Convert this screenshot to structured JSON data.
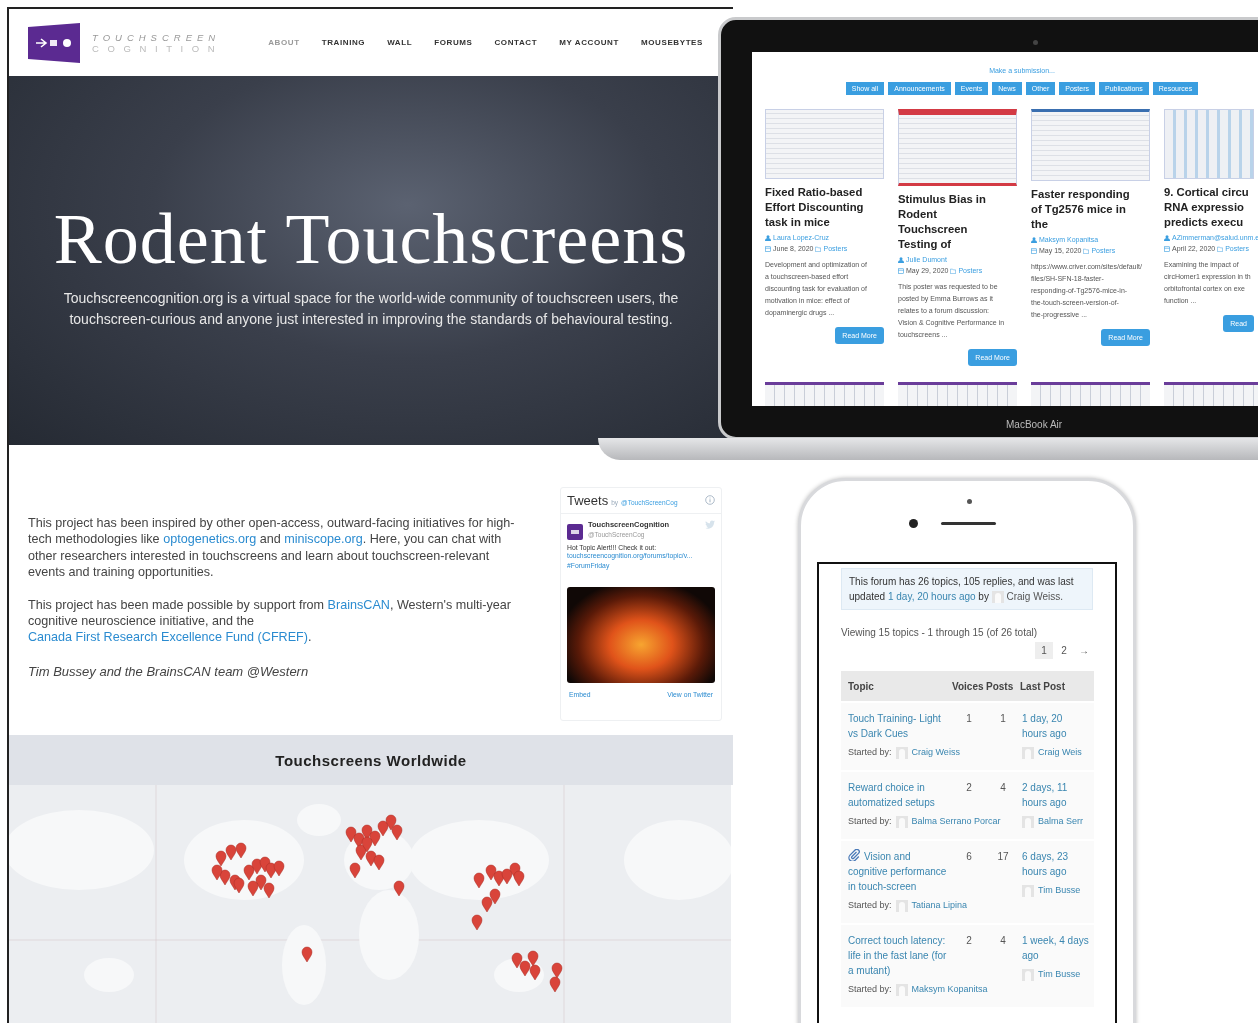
{
  "header": {
    "logo_line1": "TOUCHSCREEN",
    "logo_line2": "COGNITION",
    "nav": [
      {
        "label": "ABOUT",
        "selected": true
      },
      {
        "label": "TRAINING",
        "selected": false
      },
      {
        "label": "WALL",
        "selected": false
      },
      {
        "label": "FORUMS",
        "selected": false
      },
      {
        "label": "CONTACT",
        "selected": false
      },
      {
        "label": "MY ACCOUNT",
        "selected": false
      },
      {
        "label": "MOUSEBYTES",
        "selected": false
      }
    ]
  },
  "hero": {
    "title": "Rodent Touchscreens",
    "text": "Touchscreencognition.org is a virtual space for the world-wide community of touchscreen users, the touchscreen-curious and anyone just interested in improving the standards of behavioural testing."
  },
  "intro": {
    "paragraphs": [
      [
        {
          "text": "This project has been inspired by other open-access, outward-facing initiatives for high-tech methodologies like ",
          "link": false
        },
        {
          "text": "optogenetics.org",
          "link": true
        },
        {
          "text": " and ",
          "link": false
        },
        {
          "text": "miniscope.org",
          "link": true
        },
        {
          "text": ". Here, you can chat with other researchers interested in touchscreens and learn about touchscreen-relevant events and training opportunities.",
          "link": false
        }
      ],
      [
        {
          "text": "This project has been made possible by support from ",
          "link": false
        },
        {
          "text": "BrainsCAN",
          "link": true
        },
        {
          "text": ", Western's multi-year cognitive neuroscience initiative, and the ",
          "link": false
        },
        {
          "text": "Canada First Research Excellence Fund (CFREF)",
          "link": true
        },
        {
          "text": ".",
          "link": false
        }
      ]
    ],
    "signature": "Tim Bussey and the BrainsCAN team @Western"
  },
  "tweets": {
    "title": "Tweets",
    "by": "by",
    "handle": "@TouchScreenCog",
    "account_name": "TouchscreenCognition",
    "account_handle": "@TouchScreenCog",
    "text": "Hot Topic Alert!!!  Check it out:",
    "link": "touchscreencognition.org/forums/topic/v...",
    "hashtag": "#ForumFriday",
    "embed": "Embed",
    "view": "View on Twitter"
  },
  "map": {
    "title": "Touchscreens Worldwide"
  },
  "laptop": {
    "label": "MacBook Air",
    "submission": "Make a submission...",
    "filters": [
      "Show all",
      "Announcements",
      "Events",
      "News",
      "Other",
      "Posters",
      "Publications",
      "Resources"
    ],
    "cards": [
      {
        "title": "Fixed Ratio-based\nEffort Discounting\ntask in mice",
        "author": "Laura Lopez-Cruz",
        "date": "June 8, 2020",
        "category": "Posters",
        "excerpt": "Development and optimization of\na touchscreen-based effort\ndiscounting task for evaluation of\nmotivation in mice: effect of\ndopaminergic drugs ...",
        "button": "Read More"
      },
      {
        "title": "Stimulus Bias in\nRodent\nTouchscreen\nTesting of",
        "author": "Julie Dumont",
        "date": "May 29, 2020",
        "category": "Posters",
        "excerpt": "This poster was requested to be\nposted by Emma Burrows as it\nrelates to a forum discussion:\nVision & Cognitive Performance in\ntouchscreens ...",
        "button": "Read More"
      },
      {
        "title": "Faster responding\nof Tg2576 mice in\nthe",
        "author": "Maksym Kopanitsa",
        "date": "May 15, 2020",
        "category": "Posters",
        "excerpt": "https://www.criver.com/sites/default/\nfiles/SH-SFN-18-faster-\nresponding-of-Tg2576-mice-in-\nthe-touch-screen-version-of-\nthe-progressive ...",
        "button": "Read More"
      },
      {
        "title": "9. Cortical circu\nRNA expressio\npredicts execu",
        "author": "AZimmerman@salud.unm.e",
        "date": "April 22, 2020",
        "category": "Posters",
        "excerpt": "Examining the impact of\ncircHomer1 expression in th\norbitofrontal cortex on exe\nfunction ...",
        "button": "Read"
      }
    ]
  },
  "phone": {
    "notice": {
      "text": "This forum has 26 topics, 105 replies, and was last updated",
      "freshness": "1 day, 20 hours ago",
      "by": "by",
      "user": "Craig Weiss."
    },
    "viewing": "Viewing 15 topics - 1 through 15 (of 26 total)",
    "pages": [
      {
        "label": "1",
        "selected": true
      },
      {
        "label": "2",
        "selected": false
      },
      {
        "label": "→",
        "selected": false
      }
    ],
    "columns": [
      "Topic",
      "Voices",
      "Posts",
      "Last Post"
    ],
    "rows": [
      {
        "topic": "Touch Training- Light vs Dark Cues",
        "attachment": false,
        "voices": "1",
        "posts": "1",
        "freshness": "1 day, 20 hours ago",
        "started_label": "Started by:",
        "author": "Craig Weiss",
        "last_author": "Craig Weis"
      },
      {
        "topic": "Reward choice in automatized setups",
        "attachment": false,
        "voices": "2",
        "posts": "4",
        "freshness": "2 days, 11 hours ago",
        "started_label": "Started by:",
        "author": "Balma Serrano Porcar",
        "last_author": "Balma Serr"
      },
      {
        "topic": "Vision and cognitive performance in touch-screen",
        "attachment": true,
        "voices": "6",
        "posts": "17",
        "freshness": "6 days, 23 hours ago",
        "started_label": "Started by:",
        "author": "Tatiana Lipina",
        "last_author": "Tim Busse"
      },
      {
        "topic": "Correct touch latency: life in the fast lane (for a mutant)",
        "attachment": false,
        "voices": "2",
        "posts": "4",
        "freshness": "1 week, 4 days ago",
        "started_label": "Started by:",
        "author": "Maksym Kopanitsa",
        "last_author": "Tim Busse"
      }
    ]
  }
}
